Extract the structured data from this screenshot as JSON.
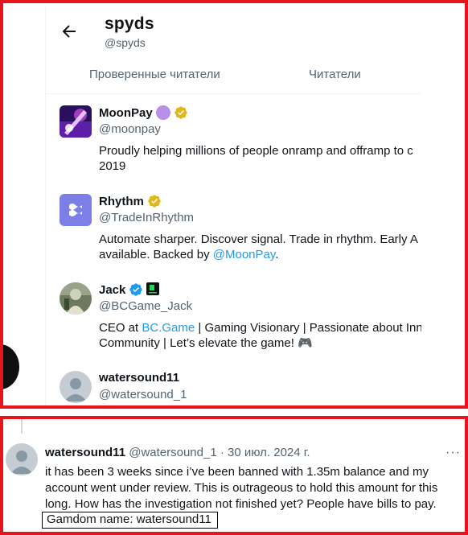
{
  "profile": {
    "name": "spyds",
    "handle": "@spyds"
  },
  "tabs": [
    {
      "label": "Проверенные читатели"
    },
    {
      "label": "Читатели"
    }
  ],
  "users": [
    {
      "name": "MoonPay",
      "handle": "@moonpay",
      "bio_line1": "Proudly helping millions of people onramp and offramp to c",
      "bio_line2": "2019"
    },
    {
      "name": "Rhythm",
      "handle": "@TradeInRhythm",
      "bio_line1": "Automate sharper. Discover signal. Trade in rhythm. Early A",
      "bio_line2_pre": "available. Backed by ",
      "bio_line2_link": "@MoonPay",
      "bio_line2_post": "."
    },
    {
      "name": "Jack",
      "handle": "@BCGame_Jack",
      "bio_line1_pre": "CEO at ",
      "bio_line1_link": "BC.Game",
      "bio_line1_post": " | Gaming Visionary | Passionate about Inn",
      "bio_line2": "Community | Let’s elevate the game! 🎮"
    },
    {
      "name": "watersound11",
      "handle": "@watersound_1"
    }
  ],
  "tweet": {
    "name": "watersound11",
    "meta": " @watersound_1 · 30 июл. 2024 г.",
    "more": "···",
    "lines": [
      "it has been 3 weeks since i’ve been banned with 1.35m balance and my",
      "account went under review. This is outrageous to hold this amount for this",
      "long. How has the investigation not finished yet? People have bills to pay."
    ],
    "gamdom": "Gamdom name: watersound11"
  },
  "colors": {
    "frame": "#e8141b",
    "link": "#1d9bf0",
    "verified": "#1d9bf0",
    "gold": "#e2b719",
    "secondary": "#536471"
  }
}
